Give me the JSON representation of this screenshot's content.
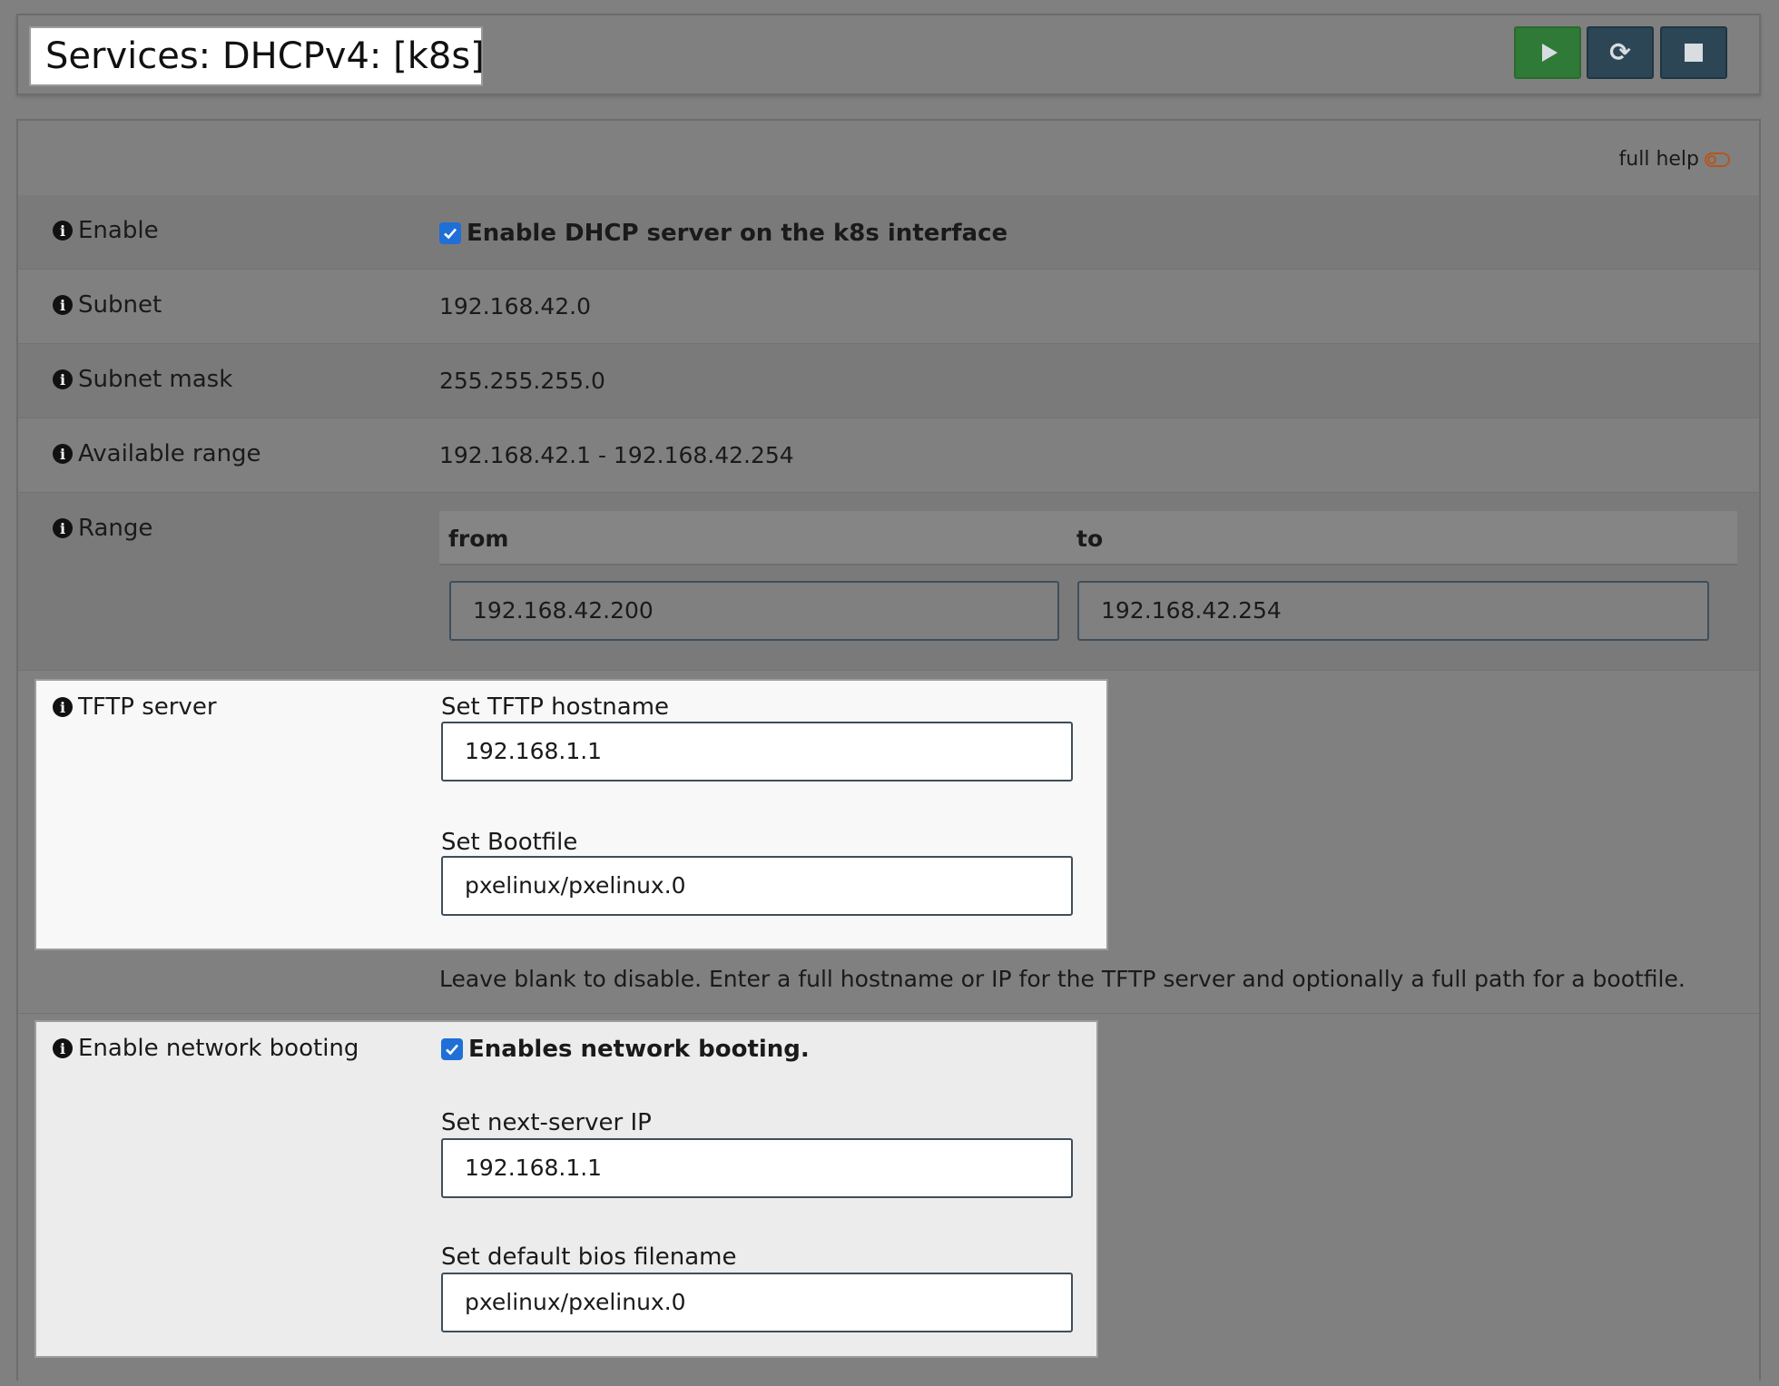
{
  "header": {
    "title": "Services: DHCPv4: [k8s]",
    "buttons": {
      "start": "play-icon",
      "restart": "refresh-icon",
      "stop": "stop-icon"
    },
    "colors": {
      "start": "#2f7a36",
      "service": "#2c4656"
    }
  },
  "panel": {
    "full_help_label": "full help"
  },
  "rows": {
    "enable": {
      "label": "Enable",
      "checkbox_label": "Enable DHCP server on the k8s interface",
      "checked": true
    },
    "subnet": {
      "label": "Subnet",
      "value": "192.168.42.0"
    },
    "subnet_mask": {
      "label": "Subnet mask",
      "value": "255.255.255.0"
    },
    "available_range": {
      "label": "Available range",
      "value": "192.168.42.1 - 192.168.42.254"
    },
    "range": {
      "label": "Range",
      "from_header": "from",
      "to_header": "to",
      "from_value": "192.168.42.200",
      "to_value": "192.168.42.254"
    },
    "tftp": {
      "label": "TFTP server",
      "hostname_label": "Set TFTP hostname",
      "hostname_value": "192.168.1.1",
      "bootfile_label": "Set Bootfile",
      "bootfile_value": "pxelinux/pxelinux.0",
      "hint": "Leave blank to disable. Enter a full hostname or IP for the TFTP server and optionally a full path for a bootfile."
    },
    "network_boot": {
      "label": "Enable network booting",
      "checkbox_label": "Enables network booting.",
      "checked": true,
      "next_server_label": "Set next-server IP",
      "next_server_value": "192.168.1.1",
      "bios_label": "Set default bios filename",
      "bios_value": "pxelinux/pxelinux.0"
    }
  }
}
